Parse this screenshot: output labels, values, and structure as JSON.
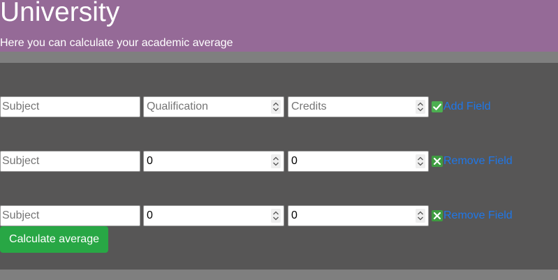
{
  "header": {
    "title": "University",
    "subtitle": "Here you can calculate your academic average",
    "background_color": "#956a97"
  },
  "form": {
    "rows": [
      {
        "subject_value": "",
        "subject_placeholder": "Subject",
        "qualification_value": "",
        "qualification_placeholder": "Qualification",
        "credits_value": "",
        "credits_placeholder": "Credits",
        "action_icon": "check-icon",
        "action_label": "Add Field"
      },
      {
        "subject_value": "",
        "subject_placeholder": "Subject",
        "qualification_value": "0",
        "qualification_placeholder": "",
        "credits_value": "0",
        "credits_placeholder": "",
        "action_icon": "cross-icon",
        "action_label": "Remove Field"
      },
      {
        "subject_value": "",
        "subject_placeholder": "Subject",
        "qualification_value": "0",
        "qualification_placeholder": "",
        "credits_value": "0",
        "credits_placeholder": "",
        "action_icon": "cross-icon",
        "action_label": "Remove Field"
      }
    ],
    "calculate_label": "Calculate average"
  },
  "colors": {
    "panel": "#575656",
    "page_background": "#7f7f7f",
    "button": "#28a745",
    "link": "#1f77e8"
  }
}
